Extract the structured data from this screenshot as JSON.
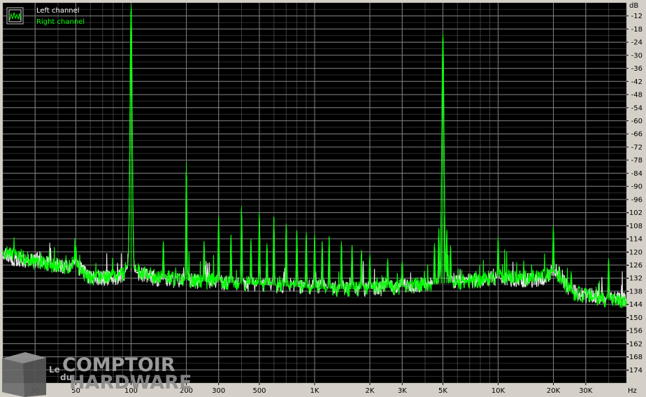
{
  "chart_data": {
    "type": "line",
    "x_scale": "log",
    "xlim": [
      20,
      50000
    ],
    "ylim": [
      -180,
      -6
    ],
    "grid": true,
    "xlabel": "Hz",
    "ylabel": "dB",
    "x_ticks": [
      {
        "value": 30,
        "label": "30"
      },
      {
        "value": 50,
        "label": "50"
      },
      {
        "value": 100,
        "label": "100"
      },
      {
        "value": 200,
        "label": "200"
      },
      {
        "value": 300,
        "label": "300"
      },
      {
        "value": 500,
        "label": "500"
      },
      {
        "value": 1000,
        "label": "1K"
      },
      {
        "value": 2000,
        "label": "2K"
      },
      {
        "value": 3000,
        "label": "3K"
      },
      {
        "value": 5000,
        "label": "5K"
      },
      {
        "value": 10000,
        "label": "10K"
      },
      {
        "value": 20000,
        "label": "20K"
      },
      {
        "value": 30000,
        "label": "30K"
      }
    ],
    "y_ticks": [
      -12,
      -18,
      -24,
      -30,
      -36,
      -42,
      -48,
      -54,
      -60,
      -66,
      -72,
      -78,
      -84,
      -90,
      -96,
      -102,
      -108,
      -114,
      -120,
      -126,
      -132,
      -138,
      -144,
      -150,
      -156,
      -162,
      -168,
      -174
    ],
    "background": "#000000",
    "grid_color": "#808080",
    "legend": {
      "placement": "top-left",
      "entries": [
        {
          "name": "Left channel",
          "color": "#ffffff"
        },
        {
          "name": "Right channel",
          "color": "#00ff00"
        }
      ]
    },
    "series": [
      {
        "name": "Left channel",
        "color": "#e8e8e8",
        "floor": [
          [
            20,
            -121
          ],
          [
            23,
            -123
          ],
          [
            27,
            -124
          ],
          [
            30,
            -124
          ],
          [
            35,
            -125
          ],
          [
            40,
            -126
          ],
          [
            45,
            -127
          ],
          [
            48,
            -125
          ],
          [
            55,
            -129
          ],
          [
            60,
            -132
          ],
          [
            70,
            -132
          ],
          [
            80,
            -132
          ],
          [
            90,
            -131
          ],
          [
            95,
            -128
          ],
          [
            120,
            -131
          ],
          [
            150,
            -133
          ],
          [
            200,
            -133
          ],
          [
            300,
            -134
          ],
          [
            500,
            -135
          ],
          [
            800,
            -136
          ],
          [
            1000,
            -136
          ],
          [
            1500,
            -137
          ],
          [
            2000,
            -137
          ],
          [
            3000,
            -136
          ],
          [
            4000,
            -135
          ],
          [
            6000,
            -134
          ],
          [
            8000,
            -133
          ],
          [
            10000,
            -132
          ],
          [
            15000,
            -133
          ],
          [
            18000,
            -132
          ],
          [
            20000,
            -131
          ],
          [
            22000,
            -132
          ],
          [
            25000,
            -138
          ],
          [
            30000,
            -140
          ],
          [
            40000,
            -141
          ],
          [
            50000,
            -142
          ]
        ],
        "peaks": [
          [
            50,
            -118
          ],
          [
            100,
            -8
          ],
          [
            150,
            -116
          ],
          [
            200,
            -80
          ],
          [
            250,
            -116
          ],
          [
            300,
            -105
          ],
          [
            350,
            -113
          ],
          [
            400,
            -100
          ],
          [
            450,
            -115
          ],
          [
            500,
            -103
          ],
          [
            550,
            -117
          ],
          [
            600,
            -105
          ],
          [
            700,
            -108
          ],
          [
            800,
            -111
          ],
          [
            900,
            -112
          ],
          [
            1000,
            -113
          ],
          [
            1100,
            -116
          ],
          [
            1200,
            -114
          ],
          [
            1400,
            -116
          ],
          [
            1600,
            -118
          ],
          [
            1800,
            -120
          ],
          [
            2000,
            -122
          ],
          [
            2500,
            -124
          ],
          [
            3000,
            -125
          ],
          [
            4500,
            -117
          ],
          [
            4750,
            -110
          ],
          [
            4900,
            -102
          ],
          [
            5000,
            -22
          ],
          [
            5100,
            -104
          ],
          [
            5250,
            -111
          ],
          [
            5500,
            -118
          ],
          [
            10000,
            -114
          ],
          [
            20000,
            -110
          ],
          [
            25000,
            -130
          ],
          [
            40000,
            -124
          ]
        ]
      },
      {
        "name": "Right channel",
        "color": "#00ff00",
        "floor": [
          [
            20,
            -120
          ],
          [
            23,
            -121
          ],
          [
            27,
            -123
          ],
          [
            30,
            -125
          ],
          [
            35,
            -126
          ],
          [
            40,
            -126
          ],
          [
            45,
            -127
          ],
          [
            48,
            -125
          ],
          [
            55,
            -130
          ],
          [
            60,
            -132
          ],
          [
            70,
            -131
          ],
          [
            80,
            -131
          ],
          [
            90,
            -130
          ],
          [
            95,
            -127
          ],
          [
            120,
            -130
          ],
          [
            150,
            -132
          ],
          [
            200,
            -133
          ],
          [
            300,
            -134
          ],
          [
            500,
            -135
          ],
          [
            800,
            -136
          ],
          [
            1000,
            -137
          ],
          [
            1500,
            -137
          ],
          [
            2000,
            -137
          ],
          [
            3000,
            -136
          ],
          [
            4000,
            -135
          ],
          [
            6000,
            -134
          ],
          [
            8000,
            -133
          ],
          [
            10000,
            -131
          ],
          [
            15000,
            -132
          ],
          [
            18000,
            -131
          ],
          [
            20000,
            -129
          ],
          [
            22000,
            -132
          ],
          [
            25000,
            -139
          ],
          [
            30000,
            -140
          ],
          [
            40000,
            -142
          ],
          [
            50000,
            -143
          ]
        ],
        "peaks": [
          [
            50,
            -117
          ],
          [
            100,
            -7
          ],
          [
            150,
            -115
          ],
          [
            200,
            -79
          ],
          [
            250,
            -115
          ],
          [
            300,
            -104
          ],
          [
            350,
            -112
          ],
          [
            400,
            -99
          ],
          [
            450,
            -114
          ],
          [
            500,
            -102
          ],
          [
            550,
            -116
          ],
          [
            600,
            -104
          ],
          [
            700,
            -107
          ],
          [
            800,
            -110
          ],
          [
            900,
            -111
          ],
          [
            1000,
            -112
          ],
          [
            1100,
            -115
          ],
          [
            1200,
            -113
          ],
          [
            1400,
            -115
          ],
          [
            1600,
            -117
          ],
          [
            1800,
            -119
          ],
          [
            2000,
            -121
          ],
          [
            2500,
            -123
          ],
          [
            3000,
            -124
          ],
          [
            4500,
            -116
          ],
          [
            4750,
            -109
          ],
          [
            4900,
            -101
          ],
          [
            5000,
            -20
          ],
          [
            5100,
            -103
          ],
          [
            5250,
            -110
          ],
          [
            5500,
            -117
          ],
          [
            10000,
            -113
          ],
          [
            20000,
            -108
          ],
          [
            25000,
            -129
          ],
          [
            40000,
            -123
          ]
        ]
      }
    ]
  },
  "watermark": {
    "le": "Le",
    "du": "du",
    "line1": "COMPTOIR",
    "line2": "HARDWARE"
  }
}
